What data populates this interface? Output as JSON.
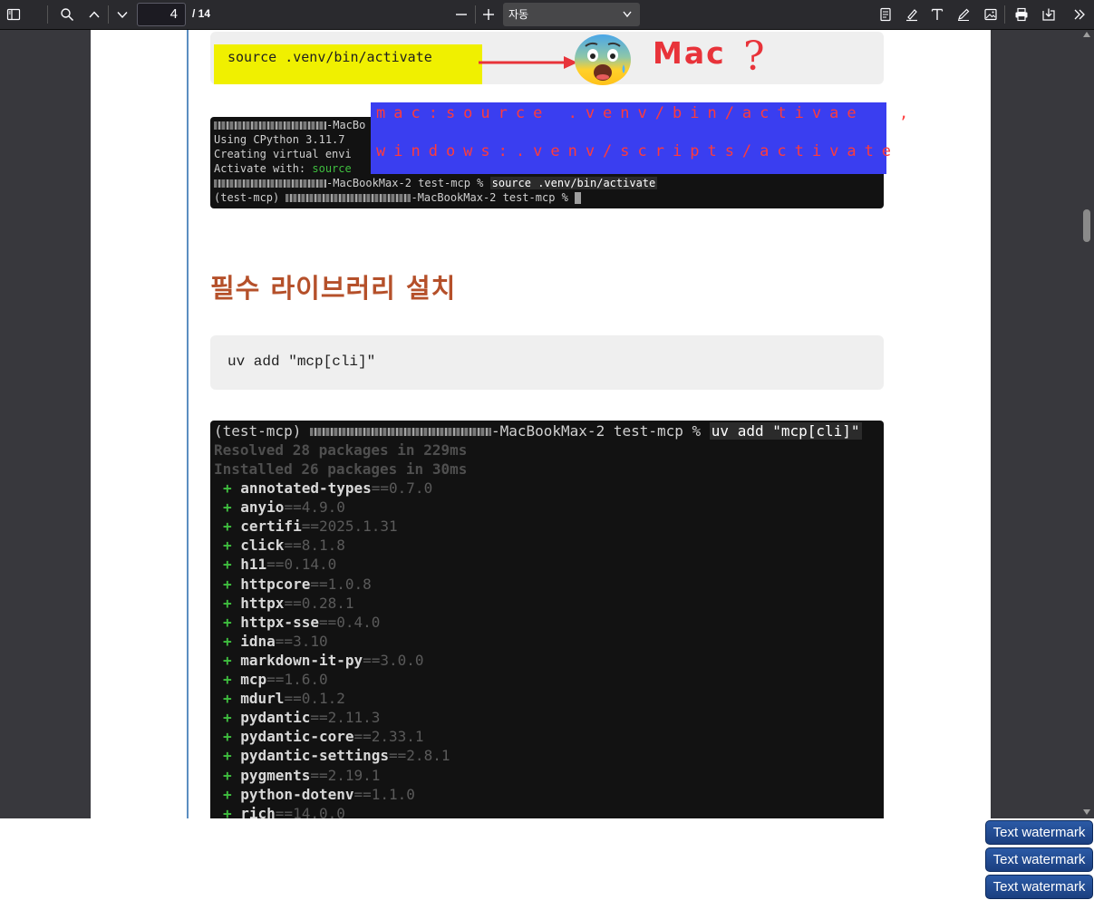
{
  "toolbar": {
    "page_number": "4",
    "page_total": "/ 14",
    "zoom_value": "자동"
  },
  "document": {
    "code_activate": "source .venv/bin/activate",
    "annotation_mac": "Mac",
    "annotation_question": "?",
    "blue_note_mac": "mac:source .venv/bin/activae  ,",
    "blue_note_windows": "windows:.venv/scripts/activate",
    "terminal1": {
      "line1_suffix": "-MacBo",
      "line2": "Using CPython 3.11.7",
      "line3": "Creating virtual envi",
      "line4_prefix": "Activate with: ",
      "line4_source": "source",
      "line5_host": "-MacBookMax-2 test-mcp % ",
      "line5_cmd": "source .venv/bin/activate",
      "line6_env": "(test-mcp) ",
      "line6_host": "-MacBookMax-2 test-mcp %"
    },
    "heading": "필수 라이브러리 설치",
    "code_uv_add": "uv add \"mcp[cli]\"",
    "terminal2": {
      "prompt_env": "(test-mcp) ",
      "prompt_host": "-MacBookMax-2 test-mcp % ",
      "prompt_cmd": "uv add \"mcp[cli]\"",
      "resolved": "Resolved 28 packages in 229ms",
      "installed": "Installed 26 packages in 30ms",
      "packages": [
        {
          "name": "annotated-types",
          "ver": "==0.7.0"
        },
        {
          "name": "anyio",
          "ver": "==4.9.0"
        },
        {
          "name": "certifi",
          "ver": "==2025.1.31"
        },
        {
          "name": "click",
          "ver": "==8.1.8"
        },
        {
          "name": "h11",
          "ver": "==0.14.0"
        },
        {
          "name": "httpcore",
          "ver": "==1.0.8"
        },
        {
          "name": "httpx",
          "ver": "==0.28.1"
        },
        {
          "name": "httpx-sse",
          "ver": "==0.4.0"
        },
        {
          "name": "idna",
          "ver": "==3.10"
        },
        {
          "name": "markdown-it-py",
          "ver": "==3.0.0"
        },
        {
          "name": "mcp",
          "ver": "==1.6.0"
        },
        {
          "name": "mdurl",
          "ver": "==0.1.2"
        },
        {
          "name": "pydantic",
          "ver": "==2.11.3"
        },
        {
          "name": "pydantic-core",
          "ver": "==2.33.1"
        },
        {
          "name": "pydantic-settings",
          "ver": "==2.8.1"
        },
        {
          "name": "pygments",
          "ver": "==2.19.1"
        },
        {
          "name": "python-dotenv",
          "ver": "==1.1.0"
        },
        {
          "name": "rich",
          "ver": "==14.0.0"
        }
      ]
    }
  },
  "watermarks": [
    "Text watermark",
    "Text watermark",
    "Text watermark"
  ],
  "colors": {
    "toolbar_bg": "#2a2a2e",
    "viewer_bg": "#38383d",
    "heading": "#b5502a",
    "highlight_yellow": "#f0f000",
    "note_blue": "#3a3ef0",
    "annotation_red": "#e8333a",
    "terminal_bg": "#121212",
    "plus_green": "#3fbf3f",
    "watermark_blue": "#2b5aa6"
  },
  "icons": [
    "sidebar-toggle-icon",
    "search-icon",
    "chevron-up-icon",
    "chevron-down-icon",
    "zoom-out-icon",
    "zoom-in-icon",
    "document-properties-icon",
    "highlight-icon",
    "text-icon",
    "draw-icon",
    "image-icon",
    "print-icon",
    "save-icon",
    "more-tools-icon"
  ]
}
